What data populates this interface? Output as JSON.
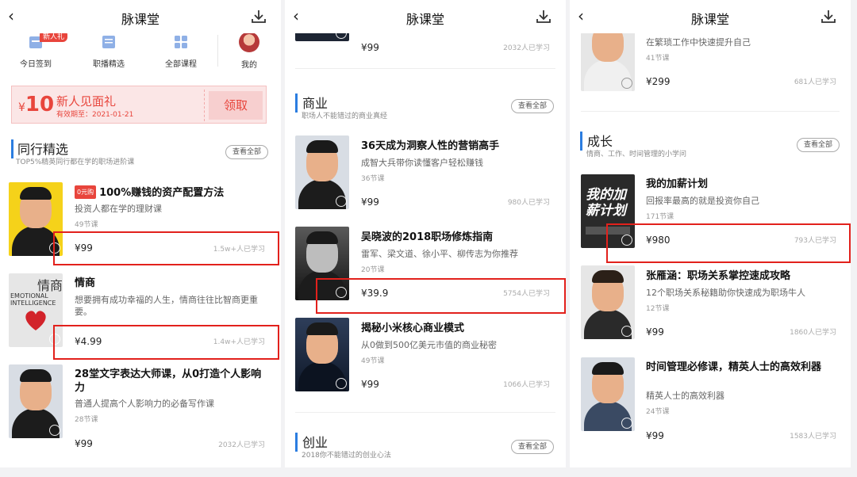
{
  "app": {
    "title": "脉课堂",
    "back_glyph": "‹"
  },
  "nav": {
    "items": [
      {
        "label": "今日签到",
        "tag": "新人礼"
      },
      {
        "label": "职播精选"
      },
      {
        "label": "全部课程"
      },
      {
        "label": "我的"
      }
    ]
  },
  "coupon": {
    "currency": "¥",
    "amount": "10",
    "title": "新人见面礼",
    "expiry": "有效期至：2021-01-21",
    "button": "领取"
  },
  "panel1": {
    "section": {
      "title": "同行精选",
      "subtitle": "TOP5%精英同行都在学的职场进阶课",
      "view_all": "查看全部"
    },
    "courses": [
      {
        "badge": "0元购",
        "title": "100%赚钱的资产配置方法",
        "desc": "投资人都在学的理财课",
        "lessons": "49节课",
        "price": "¥99",
        "learners": "1.5w+人已学习"
      },
      {
        "title": "情商",
        "desc": "想要拥有成功幸福的人生，情商往往比智商更重要。",
        "lessons": "",
        "price": "¥4.99",
        "learners": "1.4w+人已学习",
        "cover_text": "情商",
        "cover_sub": "EMOTIONAL INTELLIGENCE"
      },
      {
        "title": "28堂文字表达大师课，从0打造个人影响力",
        "desc": "普通人提高个人影响力的必备写作课",
        "lessons": "28节课",
        "price": "¥99",
        "learners": "2032人已学习"
      }
    ]
  },
  "panel2": {
    "top_course": {
      "price": "¥99",
      "learners": "2032人已学习"
    },
    "section": {
      "title": "商业",
      "subtitle": "职场人不能错过的商业真经",
      "view_all": "查看全部"
    },
    "courses": [
      {
        "title": "36天成为洞察人性的营销高手",
        "desc": "成智大兵带你读懂客户轻松赚钱",
        "lessons": "36节课",
        "price": "¥99",
        "learners": "980人已学习"
      },
      {
        "title": "吴晓波的2018职场修炼指南",
        "desc": "雷军、梁文道、徐小平、柳传志为你推荐",
        "lessons": "20节课",
        "price": "¥39.9",
        "learners": "5754人已学习"
      },
      {
        "title": "揭秘小米核心商业模式",
        "desc": "从0做到500亿美元市值的商业秘密",
        "lessons": "49节课",
        "price": "¥99",
        "learners": "1066人已学习"
      }
    ],
    "section2": {
      "title": "创业",
      "subtitle": "2018你不能错过的创业心法",
      "view_all": "查看全部"
    }
  },
  "panel3": {
    "top_course": {
      "desc": "在繁琐工作中快速提升自己",
      "lessons": "41节课",
      "price": "¥299",
      "learners": "681人已学习"
    },
    "section": {
      "title": "成长",
      "subtitle": "情商、工作、时间管理的小学问",
      "view_all": "查看全部"
    },
    "courses": [
      {
        "title": "我的加薪计划",
        "desc": "回报率最高的就是投资你自己",
        "lessons": "171节课",
        "price": "¥980",
        "learners": "793人已学习",
        "cover_text": "我的加薪计划"
      },
      {
        "title": "张雁涵：职场关系掌控速成攻略",
        "desc": "12个职场关系秘籍助你快速成为职场牛人",
        "lessons": "12节课",
        "price": "¥99",
        "learners": "1860人已学习"
      },
      {
        "title": "时间管理必修课，精英人士的高效利器",
        "desc": "精英人士的高效利器",
        "lessons": "24节课",
        "price": "¥99",
        "learners": "1583人已学习"
      }
    ]
  },
  "colors": {
    "accent": "#2b7de0",
    "red": "#e8453c",
    "highlight_box": "#e2211c"
  }
}
